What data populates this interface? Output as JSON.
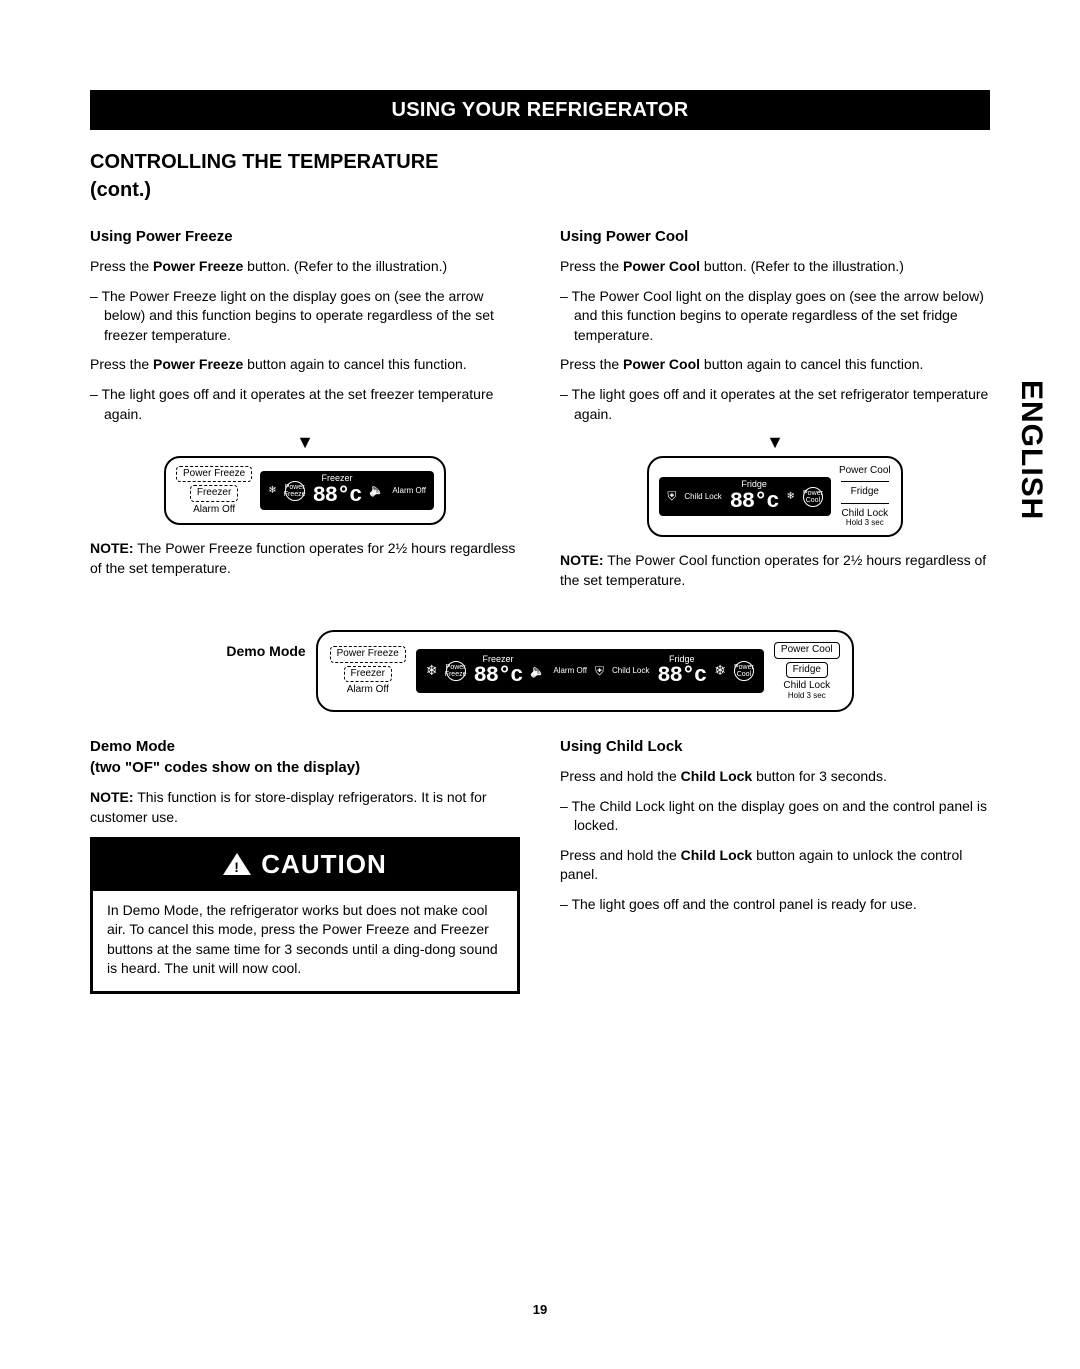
{
  "language_tab": "ENGLISH",
  "banner": "USING YOUR REFRIGERATOR",
  "main_heading_line1": "CONTROLLING THE TEMPERATURE",
  "main_heading_line2": "(cont.)",
  "page_number": "19",
  "power_freeze": {
    "heading": "Using Power Freeze",
    "p1_pre": "Press the ",
    "p1_bold": "Power Freeze",
    "p1_post": " button. (Refer to the illustration.)",
    "b1": "The Power Freeze light on the display goes on (see the arrow below) and this function begins to operate regardless of the set freezer temperature.",
    "p2_pre": "Press the ",
    "p2_bold": "Power Freeze",
    "p2_post": " button again to cancel this function.",
    "b2": "The light goes off and it operates at the set freezer temperature again.",
    "note_pre": "NOTE:",
    "note_body": " The Power Freeze function operates for 2½ hours regardless of the set temperature.",
    "panel": {
      "btn_top": "Power Freeze",
      "btn_bottom": "Freezer",
      "alarm": "Alarm Off",
      "disp_label": "Freezer",
      "badge": "Power Freeze",
      "side_label": "Alarm Off",
      "seg": "88°c"
    }
  },
  "power_cool": {
    "heading": "Using Power Cool",
    "p1_pre": "Press the ",
    "p1_bold": "Power Cool",
    "p1_post": " button. (Refer to the illustration.)",
    "b1": "The Power Cool light on the display goes on (see the arrow below) and this function begins to operate regardless of the set fridge temperature.",
    "p2_pre": "Press the ",
    "p2_bold": "Power Cool",
    "p2_post": " button again to cancel this function.",
    "b2": "The light goes off and it operates at the set refrigerator temperature again.",
    "note_pre": "NOTE:",
    "note_body": " The Power Cool function operates for 2½ hours regardless of the set temperature.",
    "panel": {
      "btn_top": "Power Cool",
      "btn_mid": "Fridge",
      "btn_bot": "Child Lock",
      "btn_bot_sub": "Hold 3 sec",
      "disp_label": "Fridge",
      "side_label": "Child Lock",
      "badge": "Power Cool",
      "seg": "88°c"
    }
  },
  "demo_panel": {
    "label": "Demo Mode",
    "left_top": "Power Freeze",
    "left_mid": "Freezer",
    "alarm": "Alarm Off",
    "freezer_label": "Freezer",
    "freezer_badge": "Power Freeze",
    "seg": "88°c",
    "alarm_off": "Alarm Off",
    "child_lock": "Child Lock",
    "fridge_label": "Fridge",
    "fridge_badge": "Power Cool",
    "right_top": "Power Cool",
    "right_mid": "Fridge",
    "right_bot": "Child Lock",
    "right_bot_sub": "Hold 3 sec"
  },
  "demo_mode": {
    "heading_line1": "Demo Mode",
    "heading_line2": "(two \"OF\" codes show on the display)",
    "note_pre": "NOTE:",
    "note_body": " This function is for store-display refrigerators. It is not for customer use."
  },
  "caution": {
    "title": "CAUTION",
    "body": "In Demo Mode, the refrigerator works but does not make cool air. To cancel this mode, press the Power Freeze and Freezer buttons at the same time for 3 seconds until a ding-dong sound is heard. The unit will now cool."
  },
  "child_lock": {
    "heading": "Using Child Lock",
    "p1_pre": "Press and hold the ",
    "p1_bold": "Child Lock",
    "p1_post": " button for 3 seconds.",
    "b1": "The Child Lock light on the display goes on and the control panel is locked.",
    "p2_pre": "Press and hold the ",
    "p2_bold": "Child Lock",
    "p2_post": " button again to unlock the control panel.",
    "b2": "The light goes off and the control panel is ready for use."
  }
}
